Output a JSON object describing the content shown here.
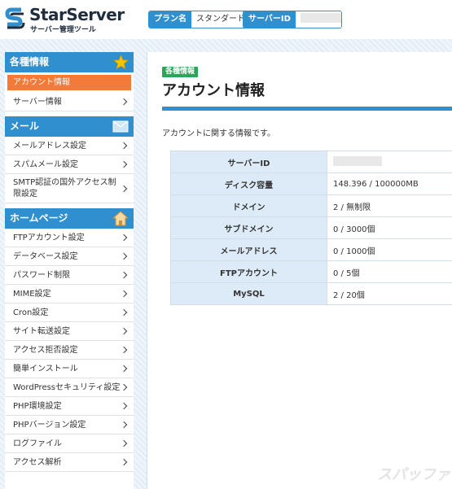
{
  "header": {
    "logo_title": "StarServer",
    "logo_subtitle": "サーバー管理ツール",
    "plan_label": "プラン名",
    "plan_value": "スタンダード",
    "server_id_label": "サーバーID",
    "server_id_value": ""
  },
  "sidebar": {
    "sections": [
      {
        "title": "各種情報",
        "icon": "star-icon",
        "items": [
          "アカウント情報",
          "サーバー情報"
        ]
      },
      {
        "title": "メール",
        "icon": "envelope-icon",
        "items": [
          "メールアドレス設定",
          "スパムメール設定",
          "SMTP認証の国外アクセス制限設定"
        ]
      },
      {
        "title": "ホームページ",
        "icon": "house-icon",
        "items": [
          "FTPアカウント設定",
          "データベース設定",
          "パスワード制限",
          "MIME設定",
          "Cron設定",
          "サイト転送設定",
          "アクセス拒否設定",
          "簡単インストール",
          "WordPressセキュリティ設定",
          "PHP環境設定",
          "PHPバージョン設定",
          "ログファイル",
          "アクセス解析"
        ]
      }
    ],
    "active_item": "アカウント情報"
  },
  "main": {
    "badge": "各種情報",
    "title": "アカウント情報",
    "description": "アカウントに関する情報です。",
    "rows": [
      {
        "label": "サーバーID",
        "value": ""
      },
      {
        "label": "ディスク容量",
        "value": "148.396 / 100000MB"
      },
      {
        "label": "ドメイン",
        "value": "2 / 無制限"
      },
      {
        "label": "サブドメイン",
        "value": "0 / 3000個"
      },
      {
        "label": "メールアドレス",
        "value": "0 / 1000個"
      },
      {
        "label": "FTPアカウント",
        "value": "0 / 5個"
      },
      {
        "label": "MySQL",
        "value": "2 / 20個"
      }
    ]
  },
  "watermark": "スパッファ",
  "colors": {
    "accent_blue": "#2f8fcf",
    "active_orange": "#f47a3a",
    "badge_green": "#2aa55a",
    "label_cell_bg": "#dcebf7"
  }
}
